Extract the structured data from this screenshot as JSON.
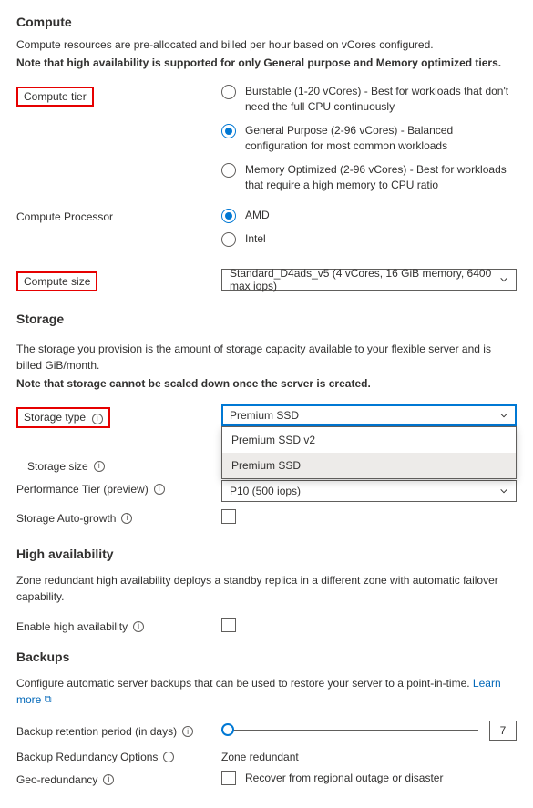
{
  "compute": {
    "heading": "Compute",
    "desc1": "Compute resources are pre-allocated and billed per hour based on vCores configured.",
    "desc2": "Note that high availability is supported for only General purpose and Memory optimized tiers.",
    "tier_label": "Compute tier",
    "tiers": [
      "Burstable (1-20 vCores) - Best for workloads that don't need the full CPU continuously",
      "General Purpose (2-96 vCores) - Balanced configuration for most common workloads",
      "Memory Optimized (2-96 vCores) - Best for workloads that require a high memory to CPU ratio"
    ],
    "processor_label": "Compute Processor",
    "processors": [
      "AMD",
      "Intel"
    ],
    "size_label": "Compute size",
    "size_value": "Standard_D4ads_v5 (4 vCores, 16 GiB memory, 6400 max iops)"
  },
  "storage": {
    "heading": "Storage",
    "desc1": "The storage you provision is the amount of storage capacity available to your flexible server and is billed GiB/month.",
    "desc2": "Note that storage cannot be scaled down once the server is created.",
    "type_label": "Storage type",
    "type_value": "Premium SSD",
    "type_options": [
      "Premium SSD v2",
      "Premium SSD"
    ],
    "size_label": "Storage size",
    "perf_label": "Performance Tier (preview)",
    "perf_value": "P10 (500 iops)",
    "autog_label": "Storage Auto-growth"
  },
  "ha": {
    "heading": "High availability",
    "desc": "Zone redundant high availability deploys a standby replica in a different zone with automatic failover capability.",
    "enable_label": "Enable high availability"
  },
  "backups": {
    "heading": "Backups",
    "desc": "Configure automatic server backups that can be used to restore your server to a point-in-time. ",
    "learn": "Learn more",
    "retention_label": "Backup retention period (in days)",
    "retention_value": "7",
    "redundancy_label": "Backup Redundancy Options",
    "redundancy_value": "Zone redundant",
    "geo_label": "Geo-redundancy",
    "geo_text": "Recover from regional outage or disaster"
  }
}
